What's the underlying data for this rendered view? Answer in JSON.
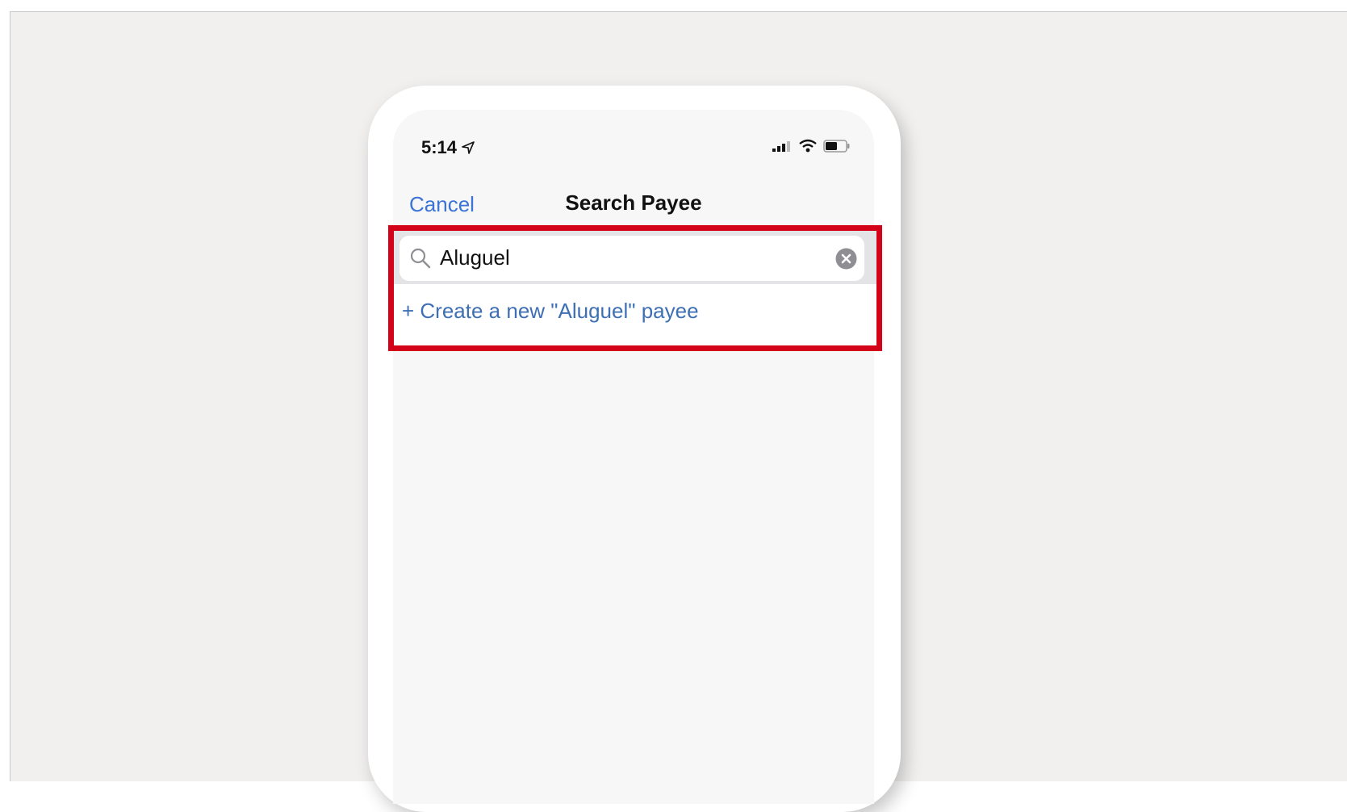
{
  "status_bar": {
    "time": "5:14"
  },
  "nav": {
    "cancel_label": "Cancel",
    "title": "Search Payee"
  },
  "search": {
    "value": "Aluguel"
  },
  "results": {
    "create_label": "+ Create a new \"Aluguel\" payee"
  },
  "colors": {
    "accent_blue": "#3b73d6",
    "highlight_red": "#d3031a",
    "background": "#f1f0ef"
  },
  "icons": [
    "location-arrow-icon",
    "signal-icon",
    "wifi-icon",
    "battery-icon",
    "search-icon",
    "clear-icon"
  ]
}
